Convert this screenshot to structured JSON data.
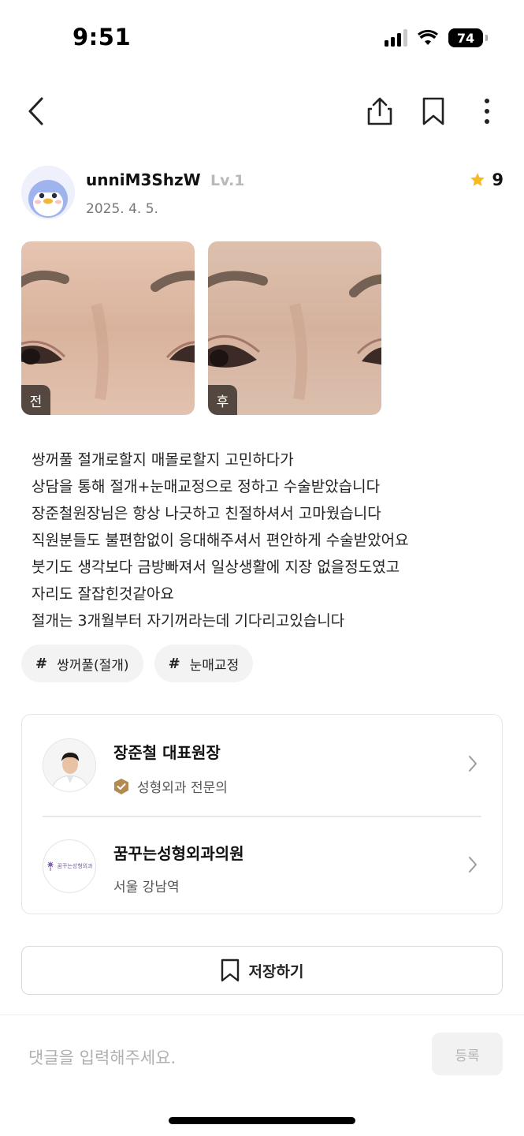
{
  "status_bar": {
    "time": "9:51",
    "battery": "74"
  },
  "nav": {
    "back_icon": "chevron-left-icon",
    "share_icon": "share-icon",
    "bookmark_icon": "bookmark-icon",
    "more_icon": "more-vertical-icon"
  },
  "author": {
    "name": "unniM3ShzW",
    "level": "Lv.1",
    "date": "2025. 4. 5.",
    "rating": "9",
    "rating_color": "#f5b921"
  },
  "photos": [
    {
      "badge": "전"
    },
    {
      "badge": "후"
    }
  ],
  "post": {
    "lines": [
      "쌍꺼풀 절개로할지 매몰로할지 고민하다가",
      "상담을 통해 절개+눈매교정으로 정하고 수술받았습니다",
      "장준철원장님은 항상 나긋하고 친절하셔서 고마웠습니다",
      "직원분들도 불편함없이 응대해주셔서 편안하게 수술받았어요",
      "붓기도 생각보다 금방빠져서 일상생활에 지장 없을정도였고",
      "자리도 잘잡힌것같아요",
      "절개는 3개월부터 자기꺼라는데 기다리고있습니다"
    ]
  },
  "tags": [
    {
      "hash": "#",
      "label": "쌍꺼풀(절개)"
    },
    {
      "hash": "#",
      "label": "눈매교정"
    }
  ],
  "doctor": {
    "name": "장준철 대표원장",
    "specialty": "성형외과 전문의",
    "badge_color": "#b58a52"
  },
  "clinic": {
    "name": "꿈꾸는성형외과의원",
    "location": "서울 강남역",
    "logo_text": "꿈꾸는성형외과"
  },
  "save_button": {
    "label": "저장하기"
  },
  "comment": {
    "placeholder": "댓글을 입력해주세요.",
    "submit_label": "등록"
  }
}
